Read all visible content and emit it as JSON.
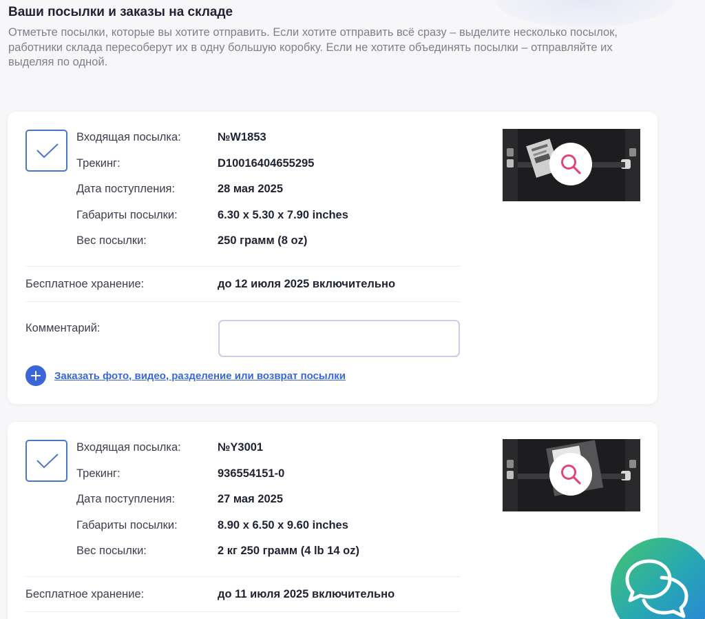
{
  "header": {
    "title": "Ваши посылки и заказы на складе",
    "description": "Отметьте посылки, которые вы хотите отправить. Если хотите отправить всё сразу – выделите несколько посылок, работники склада пересоберут их в одну большую коробку. Если не хотите объединять посылки – отправляйте их выделяя по одной."
  },
  "labels": {
    "incoming": "Входящая посылка:",
    "tracking": "Трекинг:",
    "arrival_date": "Дата поступления:",
    "dimensions": "Габариты посылки:",
    "weight": "Вес посылки:",
    "free_storage": "Бесплатное хранение:",
    "comment": "Комментарий:",
    "order_link": "Заказать фото, видео, разделение или возврат посылки"
  },
  "parcels": [
    {
      "number": "№W1853",
      "tracking": "D10016404655295",
      "arrival_date": "28 мая 2025",
      "dimensions": "6.30 x 5.30 x 7.90 inches",
      "weight": "250 грамм (8 oz)",
      "free_storage": "до 12 июля 2025 включительно",
      "comment": "",
      "checked": true
    },
    {
      "number": "№Y3001",
      "tracking": "936554151-0",
      "arrival_date": "27 мая 2025",
      "dimensions": "8.90 x 6.50 x 9.60 inches",
      "weight": "2 кг 250 грамм (4 lb 14 oz)",
      "free_storage": "до 11 июля 2025 включительно",
      "checked": true
    }
  ],
  "icons": {
    "checkmark": "checkmark-icon",
    "zoom": "magnifier-icon",
    "add": "plus-icon",
    "chat": "chat-bubbles-icon"
  },
  "colors": {
    "accent": "#3a66d8",
    "checkbox_border": "#4a76c9",
    "zoom_icon": "#e0457b",
    "chat_gradient_start": "#46c46e",
    "chat_gradient_end": "#2a7de1"
  }
}
